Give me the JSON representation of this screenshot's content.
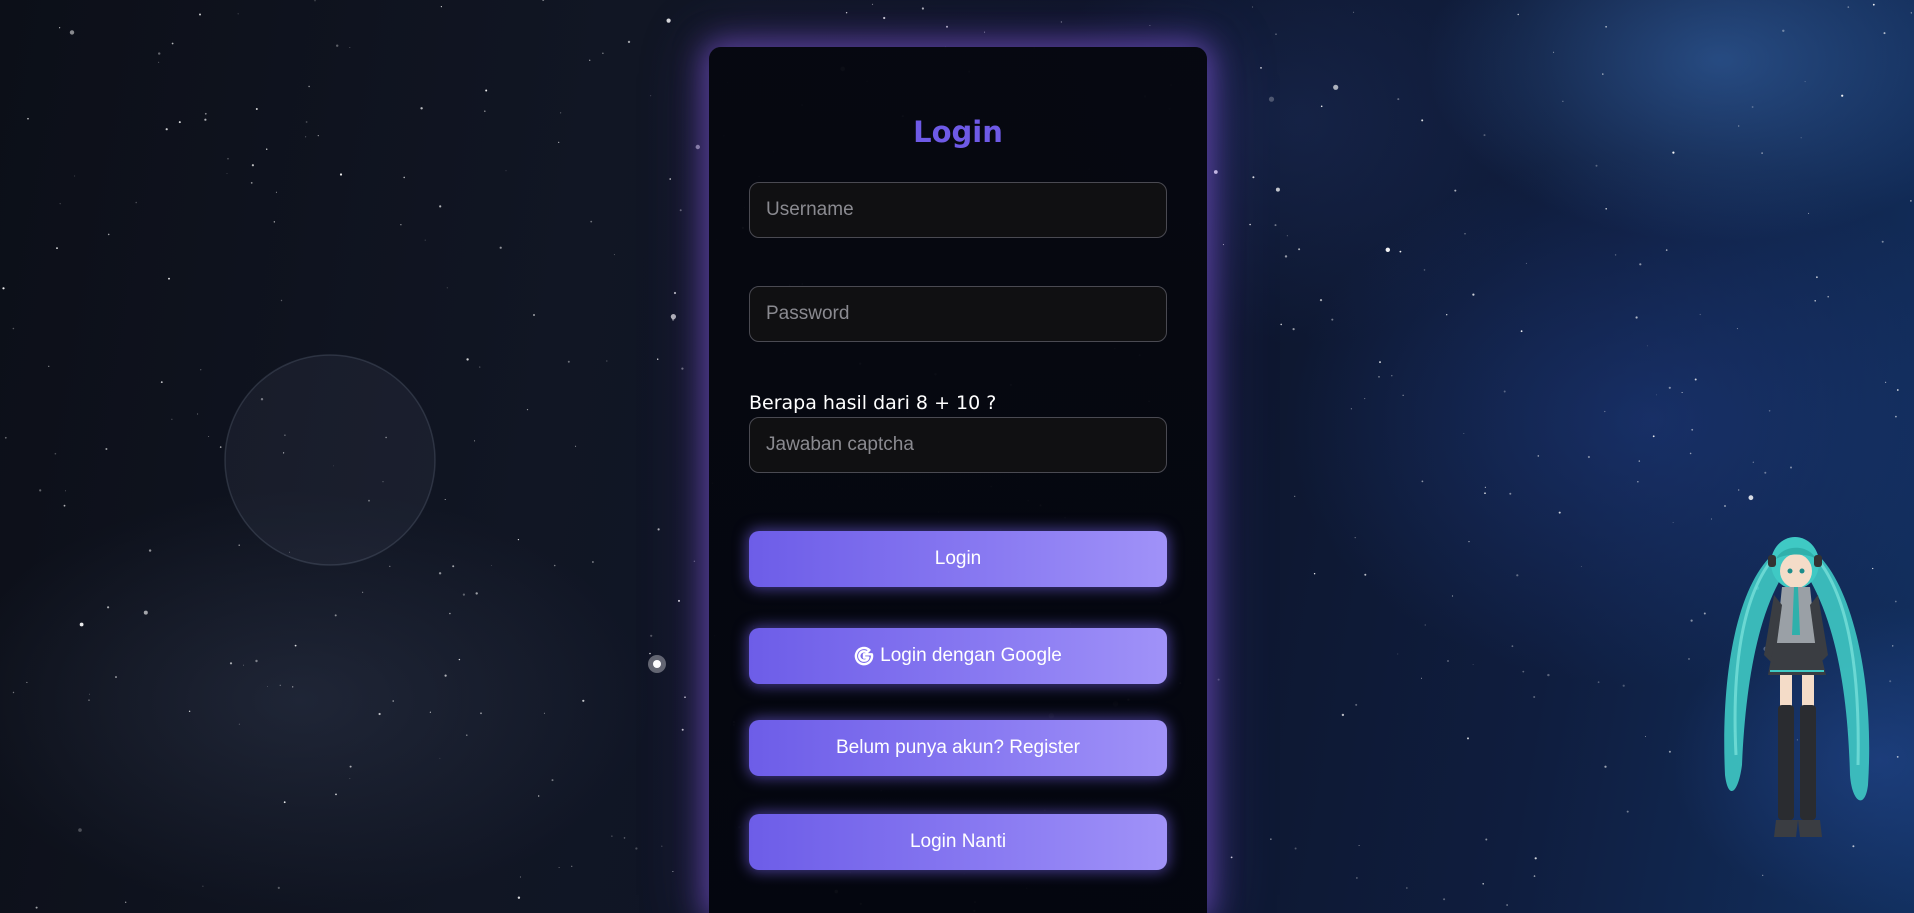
{
  "login_form": {
    "title": "Login",
    "username_placeholder": "Username",
    "password_placeholder": "Password",
    "captcha_question": "Berapa hasil dari 8 + 10 ?",
    "captcha_placeholder": "Jawaban captcha",
    "login_button": "Login",
    "google_button": "Login dengan Google",
    "google_icon": "google-g-icon",
    "register_button": "Belum punya akun? Register",
    "later_button": "Login Nanti"
  },
  "colors": {
    "accent": "#6e5ae6",
    "button_gradient_start": "#6d5de8",
    "button_gradient_end": "#a092f8",
    "panel_glow": "#825adc",
    "mascot_hair": "#3fc9c4"
  },
  "background": {
    "theme": "space-nebula",
    "mascot": "anime-character-mascot"
  }
}
